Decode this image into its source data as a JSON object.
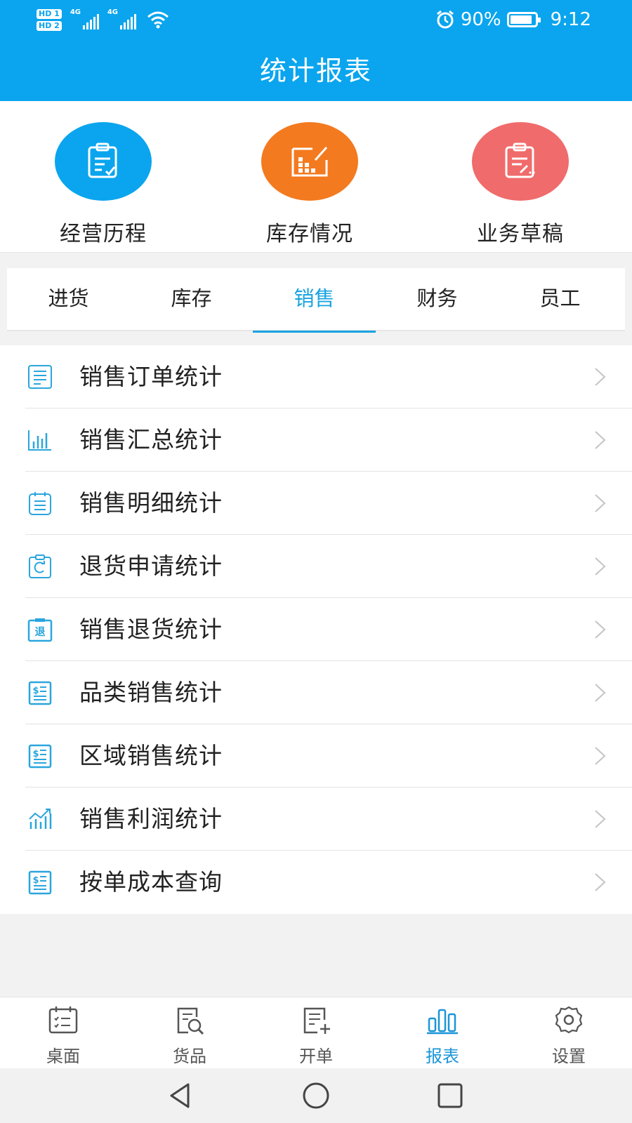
{
  "status": {
    "hd1": "HD 1",
    "hd2": "HD 2",
    "net1": "4G",
    "net2": "4G",
    "battery_pct": "90%",
    "battery_level": 0.9,
    "time": "9:12"
  },
  "header": {
    "title": "统计报表"
  },
  "quick_actions": [
    {
      "label": "经营历程",
      "icon": "clipboard-check-icon",
      "color": "#0aa5ee"
    },
    {
      "label": "库存情况",
      "icon": "inventory-chart-icon",
      "color": "#f37a1f"
    },
    {
      "label": "业务草稿",
      "icon": "clipboard-draft-icon",
      "color": "#f06b6b"
    }
  ],
  "tabs": [
    {
      "label": "进货",
      "active": false
    },
    {
      "label": "库存",
      "active": false
    },
    {
      "label": "销售",
      "active": true
    },
    {
      "label": "财务",
      "active": false
    },
    {
      "label": "员工",
      "active": false
    }
  ],
  "list": [
    {
      "label": "销售订单统计",
      "icon": "order-list-icon"
    },
    {
      "label": "销售汇总统计",
      "icon": "bar-chart-icon"
    },
    {
      "label": "销售明细统计",
      "icon": "detail-list-icon"
    },
    {
      "label": "退货申请统计",
      "icon": "return-request-icon"
    },
    {
      "label": "销售退货统计",
      "icon": "return-badge-icon"
    },
    {
      "label": "品类销售统计",
      "icon": "dollar-doc-icon"
    },
    {
      "label": "区域销售统计",
      "icon": "dollar-doc-icon"
    },
    {
      "label": "销售利润统计",
      "icon": "trend-chart-icon"
    },
    {
      "label": "按单成本查询",
      "icon": "dollar-doc-icon"
    }
  ],
  "return_badge_text": "退",
  "bottom_nav": [
    {
      "label": "桌面",
      "icon": "desktop-calendar-icon",
      "active": false
    },
    {
      "label": "货品",
      "icon": "goods-search-icon",
      "active": false
    },
    {
      "label": "开单",
      "icon": "new-order-icon",
      "active": false
    },
    {
      "label": "报表",
      "icon": "report-bars-icon",
      "active": true
    },
    {
      "label": "设置",
      "icon": "settings-gear-icon",
      "active": false
    }
  ],
  "colors": {
    "primary": "#0aa5ee",
    "tab_active": "#19a3e0",
    "nav_active": "#1b95d8",
    "orange": "#f37a1f",
    "red": "#f06b6b"
  }
}
